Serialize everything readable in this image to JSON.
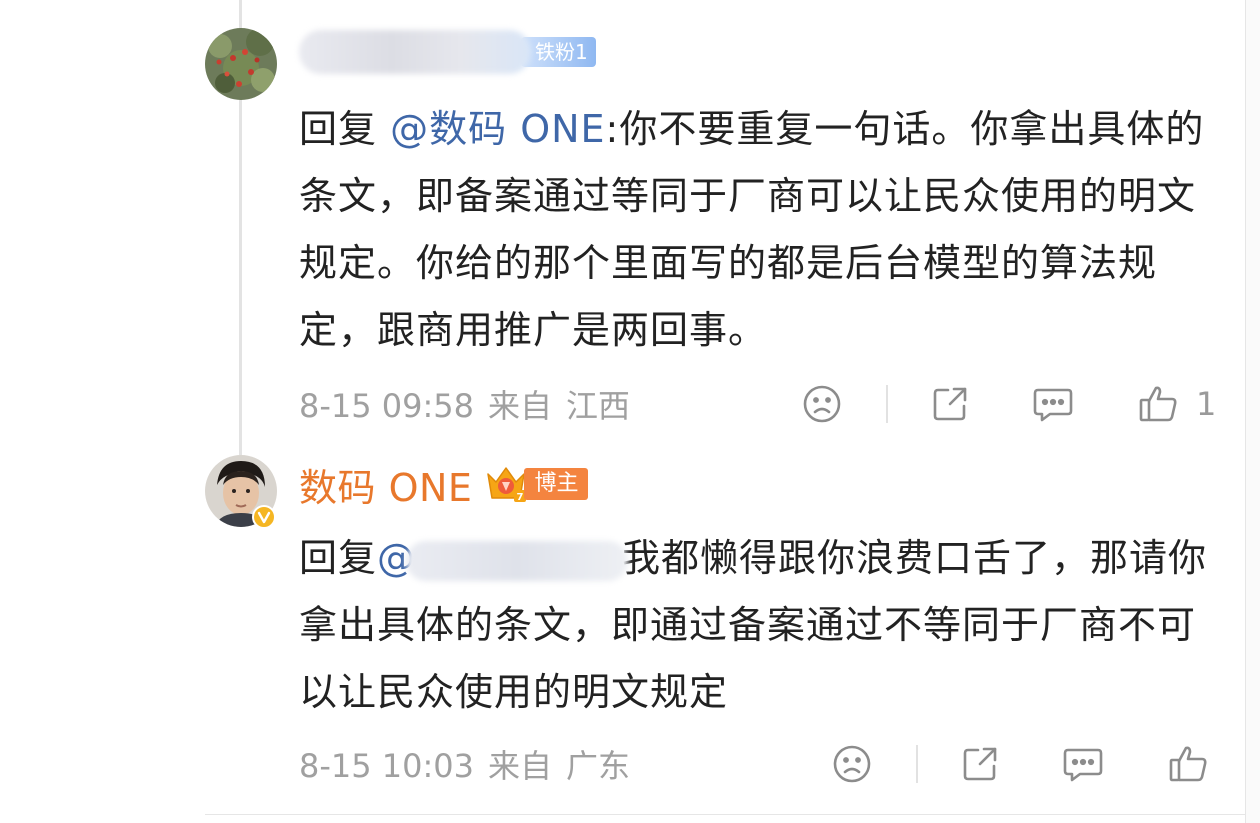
{
  "comments": [
    {
      "author_label": "",
      "fan_badge": "铁粉1",
      "reply_prefix": "回复",
      "mention": "@数码 ONE",
      "body": ":你不要重复一句话。你拿出具体的条文，即备案通过等同于厂商可以让民众使用的明文规定。你给的那个里面写的都是后台模型的算法规定，跟商用推广是两回事。",
      "date": "8-15 09:58",
      "source": "来自",
      "location": "江西",
      "like_count": "1"
    },
    {
      "author_label": "数码 ONE",
      "crown_level": "7",
      "role_badge": "博主",
      "reply_prefix": "回复",
      "mention": "@",
      "body": "我都懒得跟你浪费口舌了，那请你拿出具体的条文，即通过备案通过不等同于厂商不可以让民众使用的明文规定",
      "date": "8-15 10:03",
      "source": "来自",
      "location": "广东",
      "like_count": ""
    }
  ],
  "icons": {
    "dislike": "sad-face-icon",
    "share": "share-icon",
    "comment": "comment-icon",
    "like": "thumbs-up-icon",
    "verified": "verified-badge-icon",
    "crown": "crown-icon"
  },
  "colors": {
    "mention": "#3f67a8",
    "author": "#e8782c",
    "fan_badge": "#8fb8f1",
    "blogger_badge": "#f4843f",
    "meta": "#a0a0a0"
  }
}
